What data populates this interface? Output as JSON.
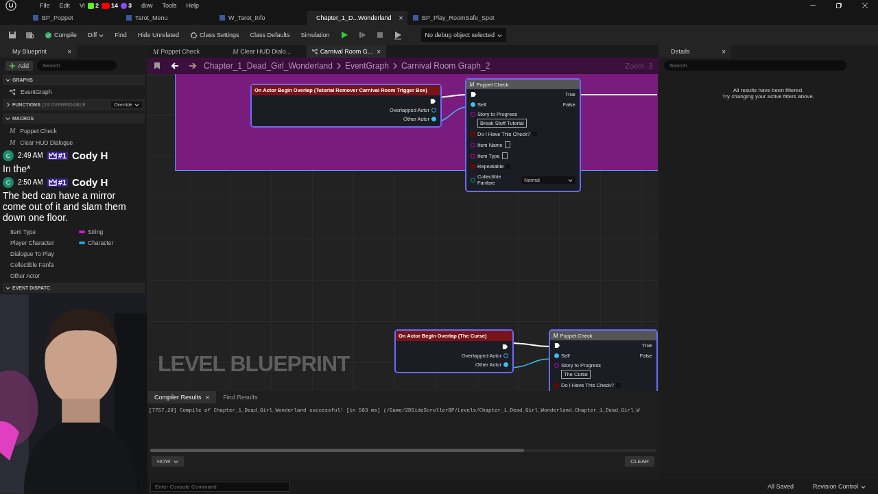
{
  "menu": [
    "File",
    "Edit",
    "Vi",
    "dow",
    "Tools",
    "Help"
  ],
  "stream_badges": [
    {
      "kind": "kick",
      "count": "2",
      "color": "#53fc18"
    },
    {
      "kind": "youtube",
      "count": "14",
      "color": "#ff0000"
    },
    {
      "kind": "twitch",
      "count": "3",
      "color": "#9146ff"
    }
  ],
  "doc_tabs": [
    {
      "label": "BP_Poppet",
      "selected": false
    },
    {
      "label": "Tarot_Menu",
      "selected": false
    },
    {
      "label": "W_Tarot_Info",
      "selected": false
    },
    {
      "label": "Chapter_1_D...Wonderland",
      "selected": true,
      "close": "×"
    },
    {
      "label": "BP_Play_RoomSafe_Spot",
      "selected": false
    }
  ],
  "toolbar": {
    "compile": "Compile",
    "diff": "Diff",
    "find": "Find",
    "hide_unrelated": "Hide Unrelated",
    "class_settings": "Class Settings",
    "class_defaults": "Class Defaults",
    "simulation": "Simulation",
    "debug_object": "No debug object selected"
  },
  "my_blueprint": {
    "title": "My Blueprint",
    "close": "×",
    "add": "Add",
    "search_placeholder": "Search",
    "sections": [
      {
        "title": "GRAPHS",
        "expanded": true,
        "items": [
          {
            "label": "EventGraph",
            "kind": "graph"
          }
        ]
      },
      {
        "title": "FUNCTIONS",
        "note": "(19 OVERRIDABLE",
        "expanded": false,
        "override": "Override"
      },
      {
        "title": "MACROS",
        "expanded": true,
        "items": [
          {
            "label": "Poppet Check",
            "kind": "macro",
            "glyph": "M"
          },
          {
            "label": "Clear HUD Dialogue",
            "kind": "macro",
            "glyph": "M"
          }
        ]
      }
    ],
    "variables": [
      {
        "name": "Item Type",
        "type": "String",
        "color": "#d21bd2"
      },
      {
        "name": "Player Character",
        "type": "Character",
        "color": "#1ea7e0"
      },
      {
        "name": "Dialogue To Play"
      },
      {
        "name": "Collectible Fanfa"
      },
      {
        "name": "Other Actor"
      }
    ],
    "event_dispatchers": "EVENT DISPATC"
  },
  "chat": [
    {
      "avatar": "C",
      "time": "2:49 AM",
      "badge": "#1",
      "user": "Cody H",
      "message": "In the*"
    },
    {
      "avatar": "C",
      "time": "2:50 AM",
      "badge": "#1",
      "user": "Cody H",
      "message": "The bed can have a mirror come out of it and slam them down one floor."
    }
  ],
  "graph_tabs": [
    {
      "label": "Poppet Check",
      "kind": "macro",
      "glyph": "M",
      "selected": false
    },
    {
      "label": "Clear HUD Dialo...",
      "kind": "macro",
      "glyph": "M",
      "selected": false
    },
    {
      "label": "Carnival Room G...",
      "kind": "graph",
      "selected": true,
      "close": "×"
    }
  ],
  "breadcrumb": [
    "Chapter_1_Dead_Girl_Wonderland",
    "EventGraph",
    "Carnival Room Graph_2"
  ],
  "zoom": "Zoom -3",
  "graph": {
    "watermark": "LEVEL BLUEPRINT",
    "events": [
      {
        "title": "On Actor Begin Overlap (Tutorial Remover Carnival Room Trigger Box)",
        "pins": [
          "Overlapped Actor",
          "Other Actor"
        ]
      },
      {
        "title": "On Actor Begin Overlap (The Curse)",
        "pins": [
          "Overlapped Actor",
          "Other Actor"
        ]
      }
    ],
    "macros": [
      {
        "glyph": "M",
        "title": "Poppet Check",
        "outputs": [
          "True",
          "False"
        ],
        "self": "Self",
        "story_label": "Story to Progress",
        "story_value": "Break Stuff Tutorial",
        "inputs": [
          {
            "kind": "bool",
            "label": "Do I Have This Check?",
            "checked": false
          },
          {
            "kind": "text",
            "label": "Item Name"
          },
          {
            "kind": "text",
            "label": "Item Type"
          },
          {
            "kind": "bool",
            "label": "Repeatable",
            "checked": false
          },
          {
            "kind": "enum",
            "label": "Collectible Fanfare",
            "value": "Normal"
          }
        ]
      },
      {
        "glyph": "M",
        "title": "Poppet Check",
        "outputs": [
          "True",
          "False"
        ],
        "self": "Self",
        "story_label": "Story to Progress",
        "story_value": "The Curse",
        "inputs": [
          {
            "kind": "bool",
            "label": "Do I Have This Check?",
            "checked": false
          }
        ]
      }
    ]
  },
  "details": {
    "title": "Details",
    "close": "×",
    "search_placeholder": "Search",
    "message": [
      "All results have been filtered.",
      "Try changing your active filters above."
    ]
  },
  "output": {
    "tabs": [
      {
        "label": "Compiler Results",
        "selected": true,
        "close": "×"
      },
      {
        "label": "Find Results",
        "selected": false
      }
    ],
    "log": "[7757.29] Compile of Chapter_1_Dead_Girl_Wonderland successful! [in 563 ms] (/Game/2DSideScrollerBP/Levels/Chapter_1_Dead_Girl_Wonderland.Chapter_1_Dead_Girl_W",
    "show": "HOW",
    "clear": "CLEAR"
  },
  "status": {
    "console_placeholder": "Enter Console Command",
    "saved": "All Saved",
    "revision": "Revision Control"
  }
}
